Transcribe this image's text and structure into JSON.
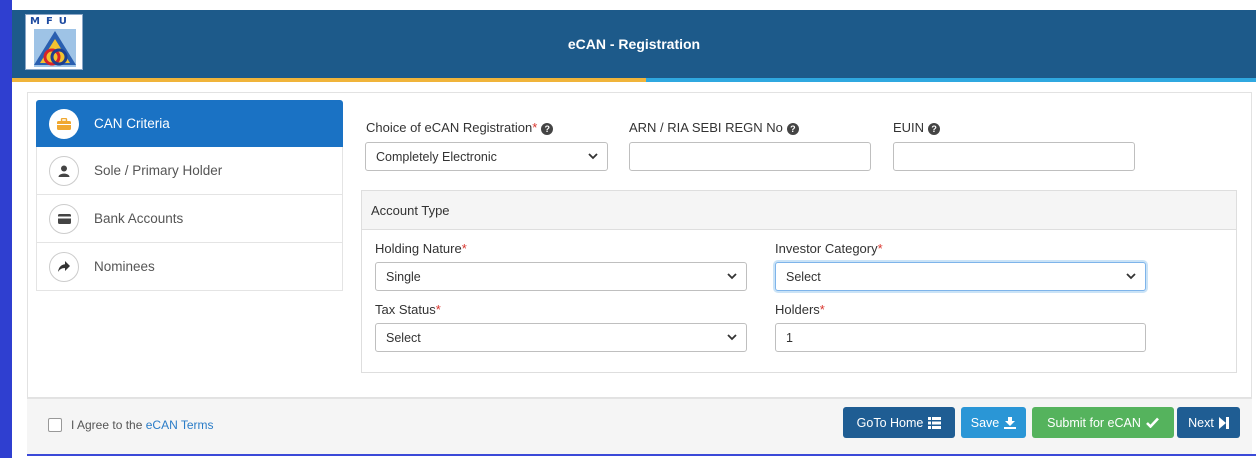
{
  "header": {
    "logo_text": "MFU",
    "title": "eCAN - Registration"
  },
  "sidebar": {
    "items": [
      {
        "label": "CAN Criteria",
        "icon": "briefcase-icon",
        "active": true
      },
      {
        "label": "Sole / Primary Holder",
        "icon": "user-icon",
        "active": false
      },
      {
        "label": "Bank Accounts",
        "icon": "credit-card-icon",
        "active": false
      },
      {
        "label": "Nominees",
        "icon": "share-arrow-icon",
        "active": false
      }
    ]
  },
  "form": {
    "choice": {
      "label": "Choice of eCAN Registration",
      "required": "*",
      "value": "Completely Electronic"
    },
    "arn": {
      "label": "ARN / RIA SEBI REGN No",
      "value": ""
    },
    "euin": {
      "label": "EUIN",
      "value": ""
    }
  },
  "account_type": {
    "title": "Account Type",
    "holding_nature": {
      "label": "Holding Nature",
      "required": "*",
      "value": "Single"
    },
    "investor_category": {
      "label": "Investor Category",
      "required": "*",
      "value": "Select"
    },
    "tax_status": {
      "label": "Tax Status",
      "required": "*",
      "value": "Select"
    },
    "holders": {
      "label": "Holders",
      "required": "*",
      "value": "1"
    }
  },
  "footer": {
    "agree_text": "I Agree to the",
    "agree_link": "eCAN Terms",
    "buttons": {
      "home": "GoTo Home",
      "save": "Save",
      "submit": "Submit for eCAN",
      "next": "Next"
    }
  },
  "colors": {
    "header_bg": "#1d5a8a",
    "active_tab": "#1a72c4",
    "submit_green": "#55b35d",
    "required_red": "#d9342c"
  }
}
